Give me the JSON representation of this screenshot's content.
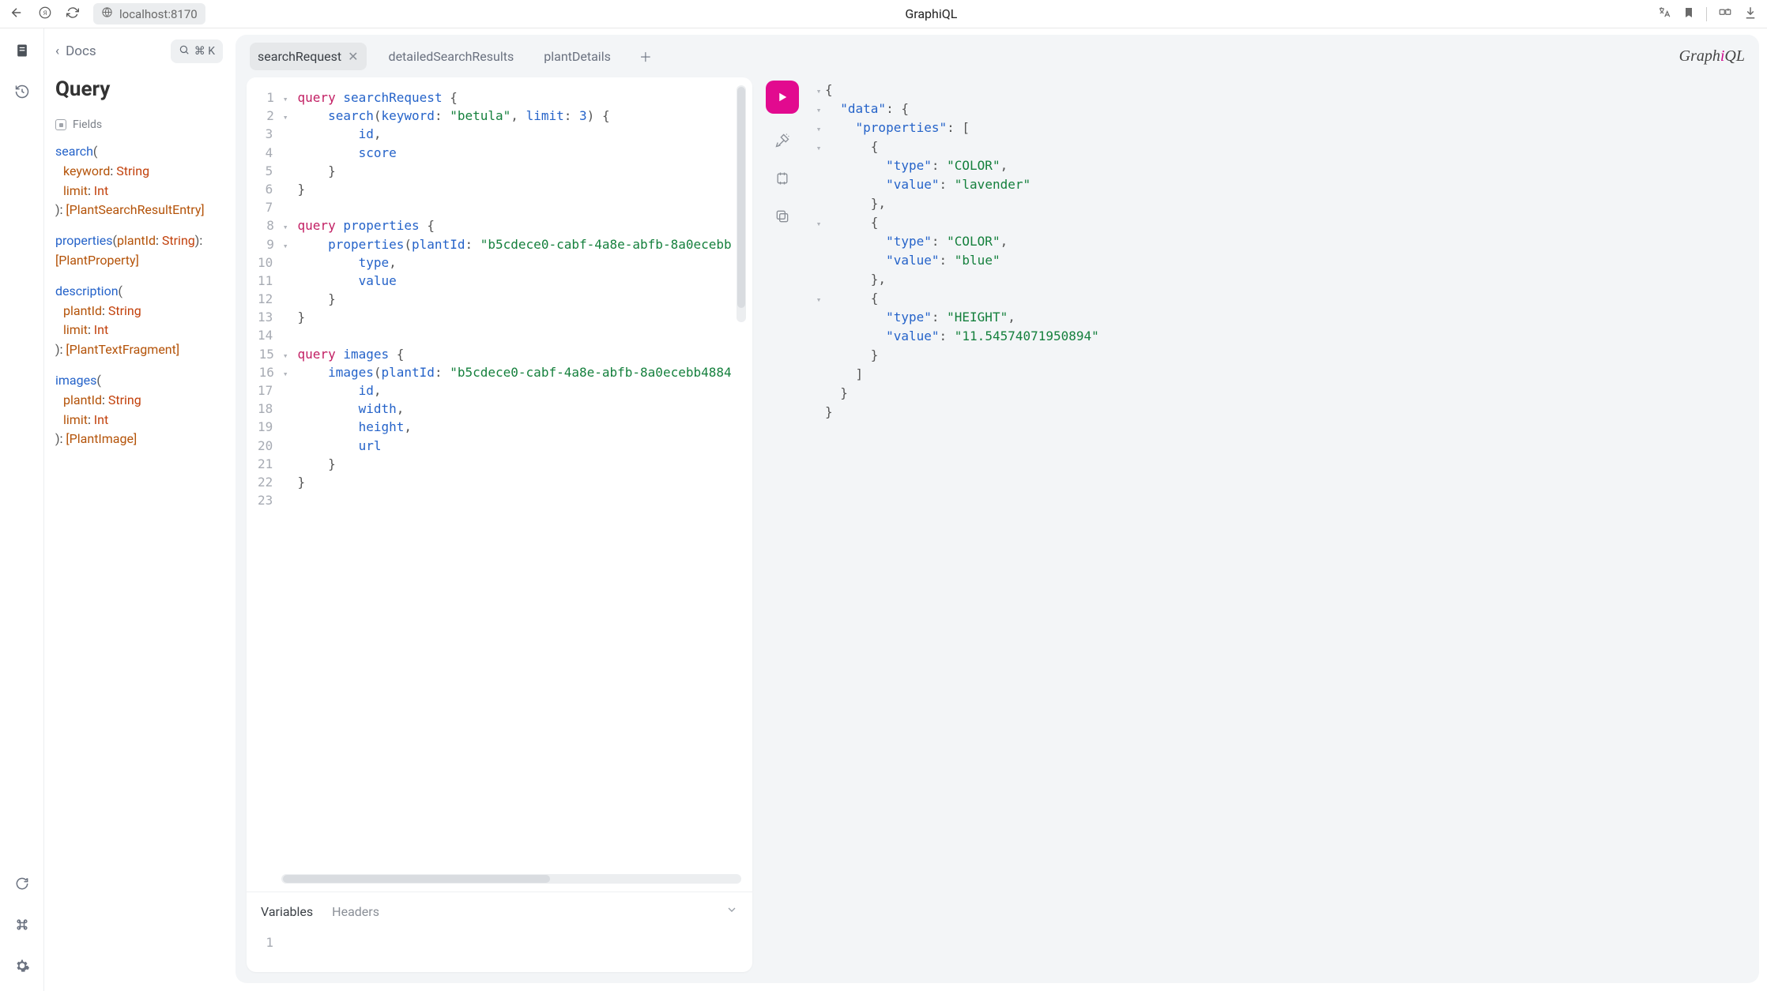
{
  "browser": {
    "address": "localhost:8170",
    "page_title": "GraphiQL"
  },
  "docs": {
    "back_label": "Docs",
    "search_shortcut": "⌘ K",
    "title": "Query",
    "fields_label": "Fields",
    "fields": [
      {
        "name": "search",
        "args": [
          {
            "name": "keyword",
            "type": "String"
          },
          {
            "name": "limit",
            "type": "Int"
          }
        ],
        "returns": "[PlantSearchResultEntry]"
      },
      {
        "name": "properties",
        "args": [
          {
            "name": "plantId",
            "type": "String"
          }
        ],
        "returns": "[PlantProperty]"
      },
      {
        "name": "description",
        "args": [
          {
            "name": "plantId",
            "type": "String"
          },
          {
            "name": "limit",
            "type": "Int"
          }
        ],
        "returns": "[PlantTextFragment]"
      },
      {
        "name": "images",
        "args": [
          {
            "name": "plantId",
            "type": "String"
          },
          {
            "name": "limit",
            "type": "Int"
          }
        ],
        "returns": "[PlantImage]"
      }
    ]
  },
  "tabs": {
    "items": [
      {
        "label": "searchRequest",
        "active": true,
        "closable": true
      },
      {
        "label": "detailedSearchResults",
        "active": false,
        "closable": false
      },
      {
        "label": "plantDetails",
        "active": false,
        "closable": false
      }
    ]
  },
  "brand": {
    "pre": "Graph",
    "i": "i",
    "post": "QL"
  },
  "editor_lines": [
    {
      "n": 1,
      "fold": "▾",
      "html": "<span class='kw'>query</span> <span class='field'>searchRequest</span> <span class='pn'>{</span>"
    },
    {
      "n": 2,
      "fold": "▾",
      "html": "    <span class='field'>search</span><span class='pn'>(</span><span class='argk'>keyword</span><span class='pn'>:</span> <span class='str'>\"betula\"</span><span class='pn'>,</span> <span class='argk'>limit</span><span class='pn'>:</span> <span class='num'>3</span><span class='pn'>)</span> <span class='pn'>{</span>"
    },
    {
      "n": 3,
      "fold": "",
      "html": "        <span class='field'>id</span><span class='pn'>,</span>"
    },
    {
      "n": 4,
      "fold": "",
      "html": "        <span class='field'>score</span>"
    },
    {
      "n": 5,
      "fold": "",
      "html": "    <span class='pn'>}</span>"
    },
    {
      "n": 6,
      "fold": "",
      "html": "<span class='pn'>}</span>"
    },
    {
      "n": 7,
      "fold": "",
      "html": ""
    },
    {
      "n": 8,
      "fold": "▾",
      "html": "<span class='kw'>query</span> <span class='field'>properties</span> <span class='pn'>{</span>"
    },
    {
      "n": 9,
      "fold": "▾",
      "html": "    <span class='field'>properties</span><span class='pn'>(</span><span class='argk'>plantId</span><span class='pn'>:</span> <span class='str'>\"b5cdece0-cabf-4a8e-abfb-8a0ecebb</span>"
    },
    {
      "n": 10,
      "fold": "",
      "html": "        <span class='field'>type</span><span class='pn'>,</span>"
    },
    {
      "n": 11,
      "fold": "",
      "html": "        <span class='field'>value</span>"
    },
    {
      "n": 12,
      "fold": "",
      "html": "    <span class='pn'>}</span>"
    },
    {
      "n": 13,
      "fold": "",
      "html": "<span class='pn'>}</span>"
    },
    {
      "n": 14,
      "fold": "",
      "html": ""
    },
    {
      "n": 15,
      "fold": "▾",
      "html": "<span class='kw'>query</span> <span class='field'>images</span> <span class='pn'>{</span>"
    },
    {
      "n": 16,
      "fold": "▾",
      "html": "    <span class='field'>images</span><span class='pn'>(</span><span class='argk'>plantId</span><span class='pn'>:</span> <span class='str'>\"b5cdece0-cabf-4a8e-abfb-8a0ecebb4884</span>"
    },
    {
      "n": 17,
      "fold": "",
      "html": "        <span class='field'>id</span><span class='pn'>,</span>"
    },
    {
      "n": 18,
      "fold": "",
      "html": "        <span class='field'>width</span><span class='pn'>,</span>"
    },
    {
      "n": 19,
      "fold": "",
      "html": "        <span class='field'>height</span><span class='pn'>,</span>"
    },
    {
      "n": 20,
      "fold": "",
      "html": "        <span class='field'>url</span>"
    },
    {
      "n": 21,
      "fold": "",
      "html": "    <span class='pn'>}</span>"
    },
    {
      "n": 22,
      "fold": "",
      "html": "<span class='pn'>}</span>"
    },
    {
      "n": 23,
      "fold": "",
      "html": ""
    }
  ],
  "vars": {
    "tabs": [
      "Variables",
      "Headers"
    ],
    "active": "Variables",
    "line1_no": "1"
  },
  "result_lines": [
    {
      "g": "▾",
      "html": "<span class='br'>{</span>"
    },
    {
      "g": "▾",
      "html": "  <span class='key'>\"data\"</span><span class='br'>: {</span>"
    },
    {
      "g": "▾",
      "html": "    <span class='key'>\"properties\"</span><span class='br'>: [</span>"
    },
    {
      "g": "▾",
      "html": "      <span class='br'>{</span>"
    },
    {
      "g": "",
      "html": "        <span class='key'>\"type\"</span><span class='br'>:</span> <span class='val'>\"COLOR\"</span><span class='br'>,</span>"
    },
    {
      "g": "",
      "html": "        <span class='key'>\"value\"</span><span class='br'>:</span> <span class='val'>\"lavender\"</span>"
    },
    {
      "g": "",
      "html": "      <span class='br'>},</span>"
    },
    {
      "g": "▾",
      "html": "      <span class='br'>{</span>"
    },
    {
      "g": "",
      "html": "        <span class='key'>\"type\"</span><span class='br'>:</span> <span class='val'>\"COLOR\"</span><span class='br'>,</span>"
    },
    {
      "g": "",
      "html": "        <span class='key'>\"value\"</span><span class='br'>:</span> <span class='val'>\"blue\"</span>"
    },
    {
      "g": "",
      "html": "      <span class='br'>},</span>"
    },
    {
      "g": "▾",
      "html": "      <span class='br'>{</span>"
    },
    {
      "g": "",
      "html": "        <span class='key'>\"type\"</span><span class='br'>:</span> <span class='val'>\"HEIGHT\"</span><span class='br'>,</span>"
    },
    {
      "g": "",
      "html": "        <span class='key'>\"value\"</span><span class='br'>:</span> <span class='val'>\"11.54574071950894\"</span>"
    },
    {
      "g": "",
      "html": "      <span class='br'>}</span>"
    },
    {
      "g": "",
      "html": "    <span class='br'>]</span>"
    },
    {
      "g": "",
      "html": "  <span class='br'>}</span>"
    },
    {
      "g": "",
      "html": "<span class='br'>}</span>"
    }
  ],
  "result_data": {
    "data": {
      "properties": [
        {
          "type": "COLOR",
          "value": "lavender"
        },
        {
          "type": "COLOR",
          "value": "blue"
        },
        {
          "type": "HEIGHT",
          "value": "11.54574071950894"
        }
      ]
    }
  }
}
